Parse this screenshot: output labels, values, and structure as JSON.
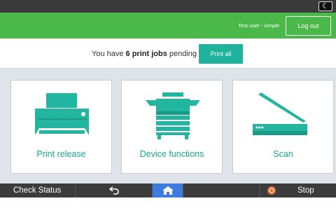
{
  "header": {
    "night_mode_icon": "moon-icon",
    "user": "Test user - simple",
    "logout_label": "Log out"
  },
  "jobs": {
    "prefix": "You have ",
    "count_text": "6 print jobs",
    "suffix": " pending",
    "print_all_label": "Print all"
  },
  "tiles": [
    {
      "label": "Print release",
      "icon": "printer-icon"
    },
    {
      "label": "Device functions",
      "icon": "copier-icon"
    },
    {
      "label": "Scan",
      "icon": "scanner-icon"
    }
  ],
  "bottom": {
    "check_status_label": "Check Status",
    "back_icon": "back-arrow-icon",
    "home_icon": "home-icon",
    "stop_label": "Stop",
    "stop_icon": "stop-icon"
  },
  "colors": {
    "brand_green": "#4bb84a",
    "accent_teal": "#1fb39e",
    "home_blue": "#3d7be0",
    "stop_orange": "#e8662a"
  }
}
